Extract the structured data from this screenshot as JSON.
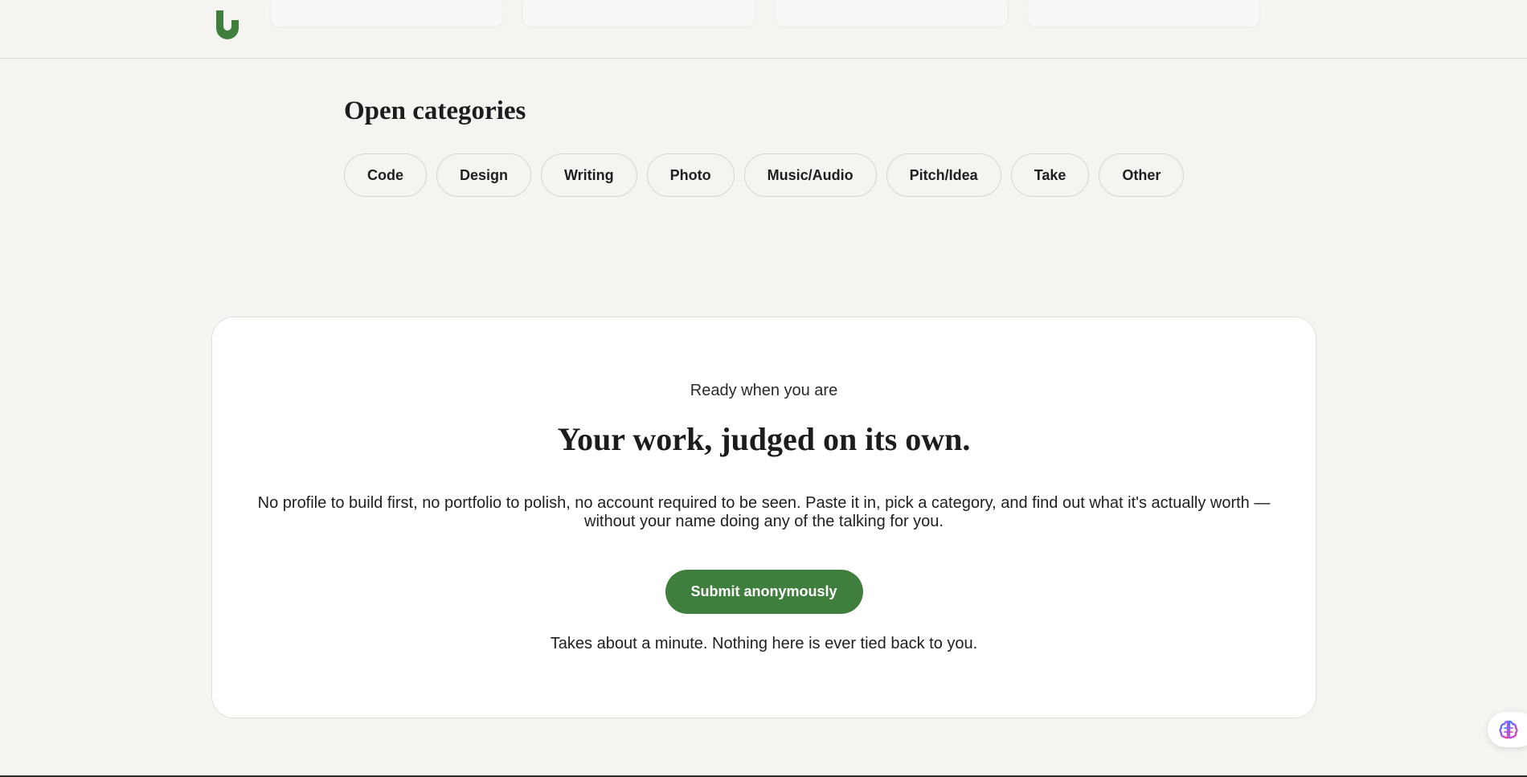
{
  "header": {
    "logo_icon": "u-logo-icon",
    "brand_color": "#3f7e3d"
  },
  "categories": {
    "title": "Open categories",
    "items": [
      {
        "label": "Code"
      },
      {
        "label": "Design"
      },
      {
        "label": "Writing"
      },
      {
        "label": "Photo"
      },
      {
        "label": "Music/Audio"
      },
      {
        "label": "Pitch/Idea"
      },
      {
        "label": "Take"
      },
      {
        "label": "Other"
      }
    ]
  },
  "cta": {
    "eyebrow": "Ready when you are",
    "heading": "Your work, judged on its own.",
    "body": "No profile to build first, no portfolio to polish, no account required to be seen. Paste it in, pick a category, and find out what it's actually worth — without your name doing any of the talking for you.",
    "button_label": "Submit anonymously",
    "footnote": "Takes about a minute. Nothing here is ever tied back to you."
  },
  "widget": {
    "icon": "brain-icon"
  }
}
